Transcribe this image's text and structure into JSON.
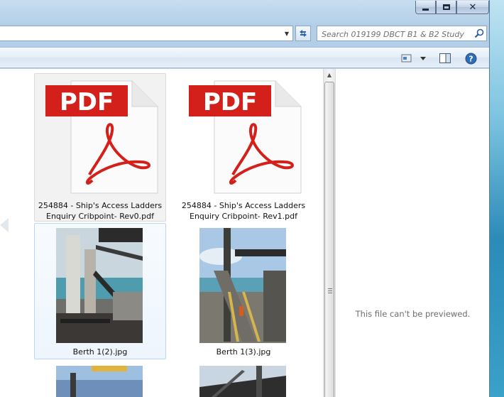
{
  "window": {
    "caption_buttons": [
      "minimize",
      "maximize",
      "close"
    ]
  },
  "search": {
    "placeholder": "Search 019199 DBCT B1 & B2 Study"
  },
  "files": [
    {
      "name_line1": "254884 - Ship's Access Ladders",
      "name_line2": "Enquiry Cribpoint- Rev0.pdf",
      "type": "pdf",
      "icon_label": "PDF"
    },
    {
      "name_line1": "254884 - Ship's Access Ladders",
      "name_line2": "Enquiry Cribpoint- Rev1.pdf",
      "type": "pdf",
      "icon_label": "PDF"
    },
    {
      "name": "Berth 1(2).jpg",
      "type": "jpg"
    },
    {
      "name": "Berth 1(3).jpg",
      "type": "jpg"
    },
    {
      "name": "",
      "type": "jpg"
    },
    {
      "name": "",
      "type": "jpg"
    }
  ],
  "preview": {
    "message": "This file can't be previewed."
  },
  "colors": {
    "pdf_red": "#d4201b",
    "selection_border": "#b8d6fb",
    "frame": "#b3cfe8"
  }
}
